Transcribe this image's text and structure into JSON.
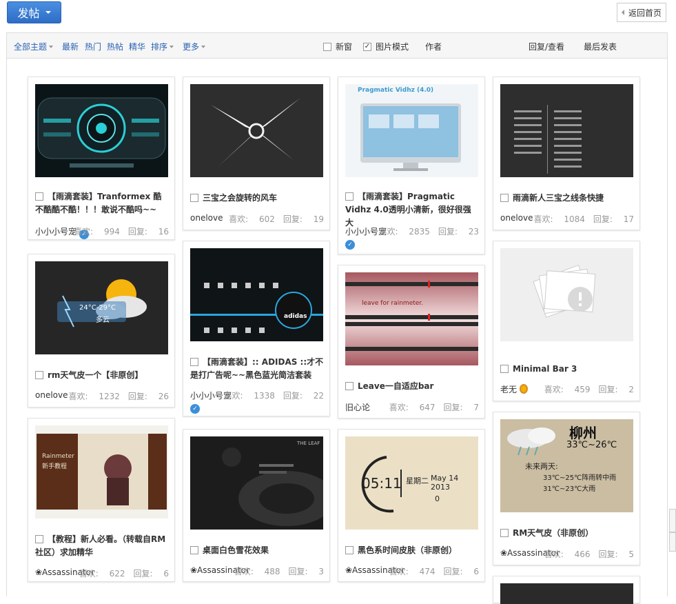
{
  "top": {
    "post_label": "发帖",
    "home_label": "返回首页"
  },
  "filters": {
    "all_topics": "全部主题",
    "latest": "最新",
    "hot": "热门",
    "hot_posts": "热帖",
    "digest": "精华",
    "sort": "排序",
    "more": "更多",
    "new_window": "新窗",
    "image_mode": "图片模式",
    "author": "作者",
    "reply_view": "回复/查看",
    "last_post": "最后发表"
  },
  "likes_prefix": "喜欢: ",
  "replies_prefix": "回复: ",
  "cards": [
    {
      "title": "【雨滴套装】Tranformex 酷不酷酷不酷！！！敢说不酷吗~~",
      "author": "小小小号宠",
      "likes": "994",
      "replies": "16"
    },
    {
      "title": "三宝之会旋转的风车",
      "author": "onelove",
      "likes": "602",
      "replies": "19"
    },
    {
      "title": "【雨滴套装】Pragmatic Vidhz 4.0透明小清新，很好很强大",
      "author": "小小小号宠",
      "likes": "2835",
      "replies": "23"
    },
    {
      "title": "雨滴新人三宝之线条快捷",
      "author": "onelove",
      "likes": "1084",
      "replies": "17"
    },
    {
      "title": "rm天气皮一个【非原创】",
      "author": "onelove",
      "likes": "1232",
      "replies": "26"
    },
    {
      "title": "【雨滴套装】:: ADIDAS ::才不是打广告呢~~黑色蓝光简洁套装",
      "author": "小小小号宠",
      "likes": "1338",
      "replies": "22"
    },
    {
      "title": "Leave一自适应bar",
      "author": "旧心论",
      "likes": "647",
      "replies": "7"
    },
    {
      "title": "Minimal Bar 3",
      "author": "老无",
      "likes": "459",
      "replies": "2"
    },
    {
      "title": "【教程】新人必看。（转载自RM社区）求加精华",
      "author": "❀Assassinator",
      "likes": "622",
      "replies": "6"
    },
    {
      "title": "桌面白色雪花效果",
      "author": "❀Assassinator",
      "likes": "488",
      "replies": "3"
    },
    {
      "title": "黑色系时间皮肤（非原创）",
      "author": "❀Assassinator",
      "likes": "474",
      "replies": "6"
    },
    {
      "title": "RM天气皮（非原创）",
      "author": "❀Assassinator",
      "likes": "466",
      "replies": "5"
    }
  ],
  "thumb_text": {
    "pragmatic": "Pragmatic Vidhz (4.0)",
    "weather_temp": "24°C-29°C",
    "weather_desc": "多云",
    "adidas": "adidas",
    "leave": "leave for rainmeter.",
    "tutorial": "Rainmeter",
    "tutorial_sub": "新手教程",
    "snow_brand": "THE LEAF",
    "clock_time": "05:11",
    "clock_day": "星期二",
    "clock_date": "May 14 2013",
    "clock_zero": "0",
    "city": "柳州",
    "city_temp": "33℃~26℃",
    "forecast_title": "未来两天:",
    "forecast_1": "33℃~25℃阵雨转中雨",
    "forecast_2": "31℃~23℃大雨"
  }
}
